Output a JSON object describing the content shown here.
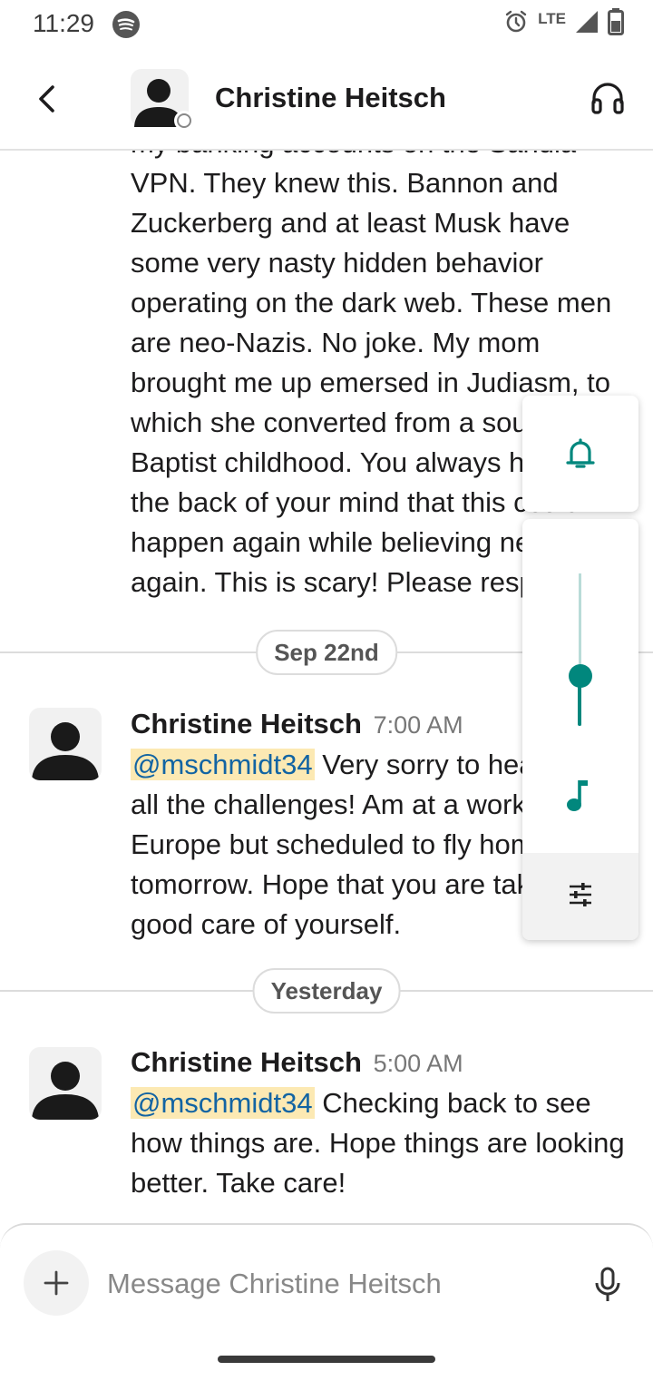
{
  "status_bar": {
    "time": "11:29",
    "network": "LTE",
    "icons": [
      "spotify-icon",
      "alarm-icon",
      "signal-icon",
      "battery-icon"
    ]
  },
  "header": {
    "title": "Christine Heitsch",
    "icons": [
      "back-arrow-icon",
      "avatar-icon",
      "headphones-icon"
    ]
  },
  "messages": {
    "continuation": {
      "text": "my banking accounts on the Sandia VPN. They knew this. Bannon and Zuckerberg and at least Musk have some very nasty hidden behavior operating on the dark web. These men are neo-Nazis. No joke. My mom brought me up emersed in Judiasm, to which she converted from a southern Baptist childhood. You always have in the back of your mind that this could happen again while believing never again. This is scary! Please respond."
    },
    "date1": "Sep 22nd",
    "msg1": {
      "name": "Christine Heitsch",
      "time": "7:00 AM",
      "mention": "@mschmidt34",
      "text": " Very sorry to hear about all the challenges!   Am at a workshop in Europe but scheduled to fly home tomorrow.  Hope that you are taking good care of yourself."
    },
    "date2": "Yesterday",
    "msg2": {
      "name": "Christine Heitsch",
      "time": "5:00 AM",
      "mention": "@mschmidt34",
      "text": " Checking back to see how things are.  Hope things are looking better.  Take care!"
    }
  },
  "volume_panel": {
    "level": 0.33,
    "accent": "#01877d",
    "icons": [
      "bell-icon",
      "music-note-icon",
      "sliders-icon"
    ]
  },
  "composer": {
    "placeholder": "Message Christine Heitsch",
    "value": "",
    "icons": [
      "plus-icon",
      "microphone-icon"
    ]
  }
}
